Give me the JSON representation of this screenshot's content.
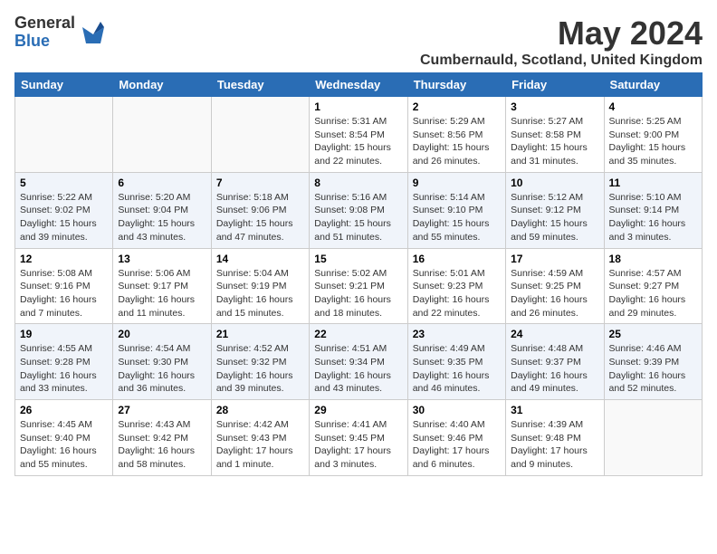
{
  "logo": {
    "general": "General",
    "blue": "Blue"
  },
  "title": "May 2024",
  "location": "Cumbernauld, Scotland, United Kingdom",
  "headers": [
    "Sunday",
    "Monday",
    "Tuesday",
    "Wednesday",
    "Thursday",
    "Friday",
    "Saturday"
  ],
  "weeks": [
    [
      {
        "day": "",
        "info": ""
      },
      {
        "day": "",
        "info": ""
      },
      {
        "day": "",
        "info": ""
      },
      {
        "day": "1",
        "info": "Sunrise: 5:31 AM\nSunset: 8:54 PM\nDaylight: 15 hours\nand 22 minutes."
      },
      {
        "day": "2",
        "info": "Sunrise: 5:29 AM\nSunset: 8:56 PM\nDaylight: 15 hours\nand 26 minutes."
      },
      {
        "day": "3",
        "info": "Sunrise: 5:27 AM\nSunset: 8:58 PM\nDaylight: 15 hours\nand 31 minutes."
      },
      {
        "day": "4",
        "info": "Sunrise: 5:25 AM\nSunset: 9:00 PM\nDaylight: 15 hours\nand 35 minutes."
      }
    ],
    [
      {
        "day": "5",
        "info": "Sunrise: 5:22 AM\nSunset: 9:02 PM\nDaylight: 15 hours\nand 39 minutes."
      },
      {
        "day": "6",
        "info": "Sunrise: 5:20 AM\nSunset: 9:04 PM\nDaylight: 15 hours\nand 43 minutes."
      },
      {
        "day": "7",
        "info": "Sunrise: 5:18 AM\nSunset: 9:06 PM\nDaylight: 15 hours\nand 47 minutes."
      },
      {
        "day": "8",
        "info": "Sunrise: 5:16 AM\nSunset: 9:08 PM\nDaylight: 15 hours\nand 51 minutes."
      },
      {
        "day": "9",
        "info": "Sunrise: 5:14 AM\nSunset: 9:10 PM\nDaylight: 15 hours\nand 55 minutes."
      },
      {
        "day": "10",
        "info": "Sunrise: 5:12 AM\nSunset: 9:12 PM\nDaylight: 15 hours\nand 59 minutes."
      },
      {
        "day": "11",
        "info": "Sunrise: 5:10 AM\nSunset: 9:14 PM\nDaylight: 16 hours\nand 3 minutes."
      }
    ],
    [
      {
        "day": "12",
        "info": "Sunrise: 5:08 AM\nSunset: 9:16 PM\nDaylight: 16 hours\nand 7 minutes."
      },
      {
        "day": "13",
        "info": "Sunrise: 5:06 AM\nSunset: 9:17 PM\nDaylight: 16 hours\nand 11 minutes."
      },
      {
        "day": "14",
        "info": "Sunrise: 5:04 AM\nSunset: 9:19 PM\nDaylight: 16 hours\nand 15 minutes."
      },
      {
        "day": "15",
        "info": "Sunrise: 5:02 AM\nSunset: 9:21 PM\nDaylight: 16 hours\nand 18 minutes."
      },
      {
        "day": "16",
        "info": "Sunrise: 5:01 AM\nSunset: 9:23 PM\nDaylight: 16 hours\nand 22 minutes."
      },
      {
        "day": "17",
        "info": "Sunrise: 4:59 AM\nSunset: 9:25 PM\nDaylight: 16 hours\nand 26 minutes."
      },
      {
        "day": "18",
        "info": "Sunrise: 4:57 AM\nSunset: 9:27 PM\nDaylight: 16 hours\nand 29 minutes."
      }
    ],
    [
      {
        "day": "19",
        "info": "Sunrise: 4:55 AM\nSunset: 9:28 PM\nDaylight: 16 hours\nand 33 minutes."
      },
      {
        "day": "20",
        "info": "Sunrise: 4:54 AM\nSunset: 9:30 PM\nDaylight: 16 hours\nand 36 minutes."
      },
      {
        "day": "21",
        "info": "Sunrise: 4:52 AM\nSunset: 9:32 PM\nDaylight: 16 hours\nand 39 minutes."
      },
      {
        "day": "22",
        "info": "Sunrise: 4:51 AM\nSunset: 9:34 PM\nDaylight: 16 hours\nand 43 minutes."
      },
      {
        "day": "23",
        "info": "Sunrise: 4:49 AM\nSunset: 9:35 PM\nDaylight: 16 hours\nand 46 minutes."
      },
      {
        "day": "24",
        "info": "Sunrise: 4:48 AM\nSunset: 9:37 PM\nDaylight: 16 hours\nand 49 minutes."
      },
      {
        "day": "25",
        "info": "Sunrise: 4:46 AM\nSunset: 9:39 PM\nDaylight: 16 hours\nand 52 minutes."
      }
    ],
    [
      {
        "day": "26",
        "info": "Sunrise: 4:45 AM\nSunset: 9:40 PM\nDaylight: 16 hours\nand 55 minutes."
      },
      {
        "day": "27",
        "info": "Sunrise: 4:43 AM\nSunset: 9:42 PM\nDaylight: 16 hours\nand 58 minutes."
      },
      {
        "day": "28",
        "info": "Sunrise: 4:42 AM\nSunset: 9:43 PM\nDaylight: 17 hours\nand 1 minute."
      },
      {
        "day": "29",
        "info": "Sunrise: 4:41 AM\nSunset: 9:45 PM\nDaylight: 17 hours\nand 3 minutes."
      },
      {
        "day": "30",
        "info": "Sunrise: 4:40 AM\nSunset: 9:46 PM\nDaylight: 17 hours\nand 6 minutes."
      },
      {
        "day": "31",
        "info": "Sunrise: 4:39 AM\nSunset: 9:48 PM\nDaylight: 17 hours\nand 9 minutes."
      },
      {
        "day": "",
        "info": ""
      }
    ]
  ]
}
